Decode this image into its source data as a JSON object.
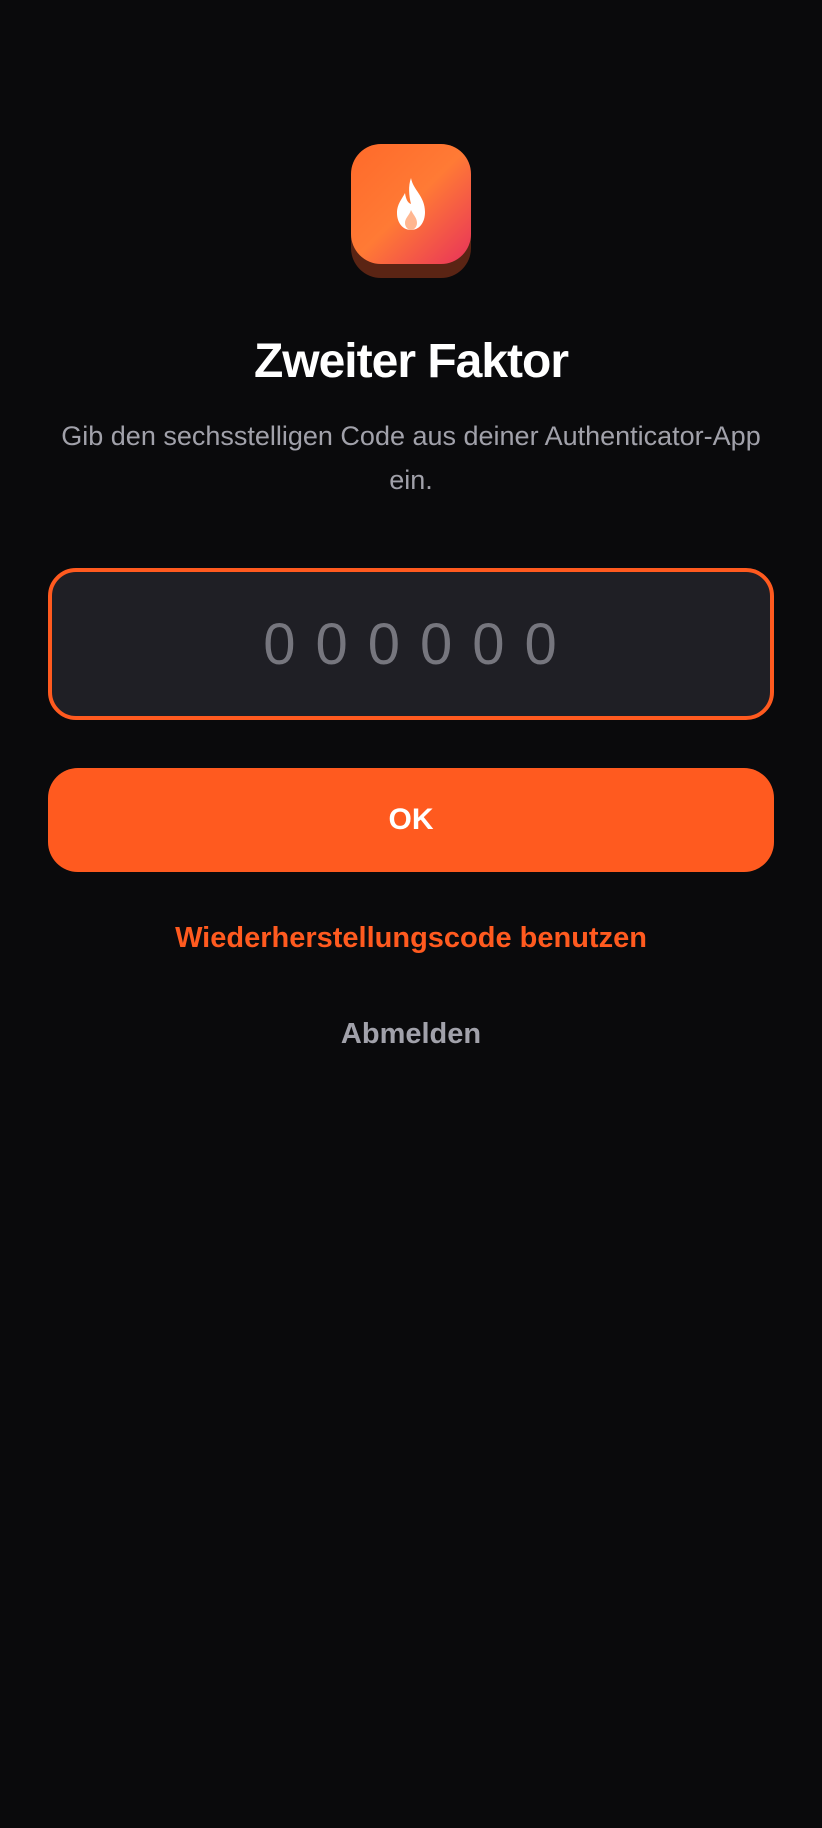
{
  "app": {
    "logo_icon": "flame-icon",
    "logo_gradient": [
      "#ff6a2a",
      "#e8325a"
    ]
  },
  "header": {
    "title": "Zweiter Faktor",
    "subtitle": "Gib den sechsstelligen Code aus deiner Authenticator-App ein."
  },
  "form": {
    "code_value": "",
    "code_placeholder": "000000",
    "ok_label": "OK"
  },
  "links": {
    "recovery_label": "Wiederherstellungscode benutzen",
    "logout_label": "Abmelden"
  },
  "colors": {
    "accent": "#ff5a1f",
    "background": "#0a0a0c",
    "muted_text": "#a1a1aa",
    "input_bg": "#1f1f25"
  }
}
